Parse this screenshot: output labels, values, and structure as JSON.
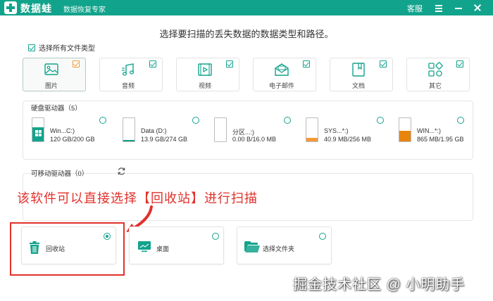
{
  "titlebar": {
    "app_name": "数据蛙",
    "app_subtitle": "数据恢复专家",
    "service": "客服"
  },
  "heading": "选择要扫描的丢失数据的数据类型和路径。",
  "select_all": {
    "label": "选择所有文件类型",
    "checked": true
  },
  "file_types": [
    {
      "label": "图片",
      "icon": "image-icon",
      "checked": true,
      "selected": true
    },
    {
      "label": "音频",
      "icon": "music-icon",
      "checked": true
    },
    {
      "label": "视频",
      "icon": "video-icon",
      "checked": true
    },
    {
      "label": "电子邮件",
      "icon": "email-icon",
      "checked": true
    },
    {
      "label": "文档",
      "icon": "document-icon",
      "checked": true
    },
    {
      "label": "其它",
      "icon": "other-icon",
      "checked": true
    }
  ],
  "hard_drives": {
    "title": "硬盘驱动器（5）",
    "items": [
      {
        "name": "Win...C:)",
        "size": "120 GB/200 GB",
        "fill_color": "#12a38c",
        "used_fraction": 0.6
      },
      {
        "name": "Data (D:)",
        "size": "13.9 GB/274 GB",
        "fill_color": "#12a38c",
        "used_fraction": 0.05
      },
      {
        "name": "分区...:)",
        "size": "0.00  B/16.0 MB",
        "fill_color": "#f39a36",
        "used_fraction": 0.0
      },
      {
        "name": "SYS...*:)",
        "size": "40.9 MB/256 MB",
        "fill_color": "#f39a36",
        "used_fraction": 0.16
      },
      {
        "name": "WIN...*:)",
        "size": "865 MB/1.95 GB",
        "fill_color": "#e8850f",
        "used_fraction": 0.44
      }
    ]
  },
  "removable": {
    "title": "可移动驱动器（0）",
    "refresh_icon": "refresh-icon"
  },
  "annotation": "该软件可以直接选择【回收站】进行扫描",
  "locations": [
    {
      "label": "回收站",
      "icon": "trash-icon",
      "selected": true
    },
    {
      "label": "桌面",
      "icon": "desktop-icon",
      "selected": false
    },
    {
      "label": "选择文件夹",
      "icon": "folder-icon",
      "selected": false
    }
  ],
  "watermark": "掘金技术社区 @ 小明助手",
  "colors": {
    "brand": "#12a38c",
    "accent_orange": "#f39a36",
    "annotation_red": "#e2302a"
  }
}
